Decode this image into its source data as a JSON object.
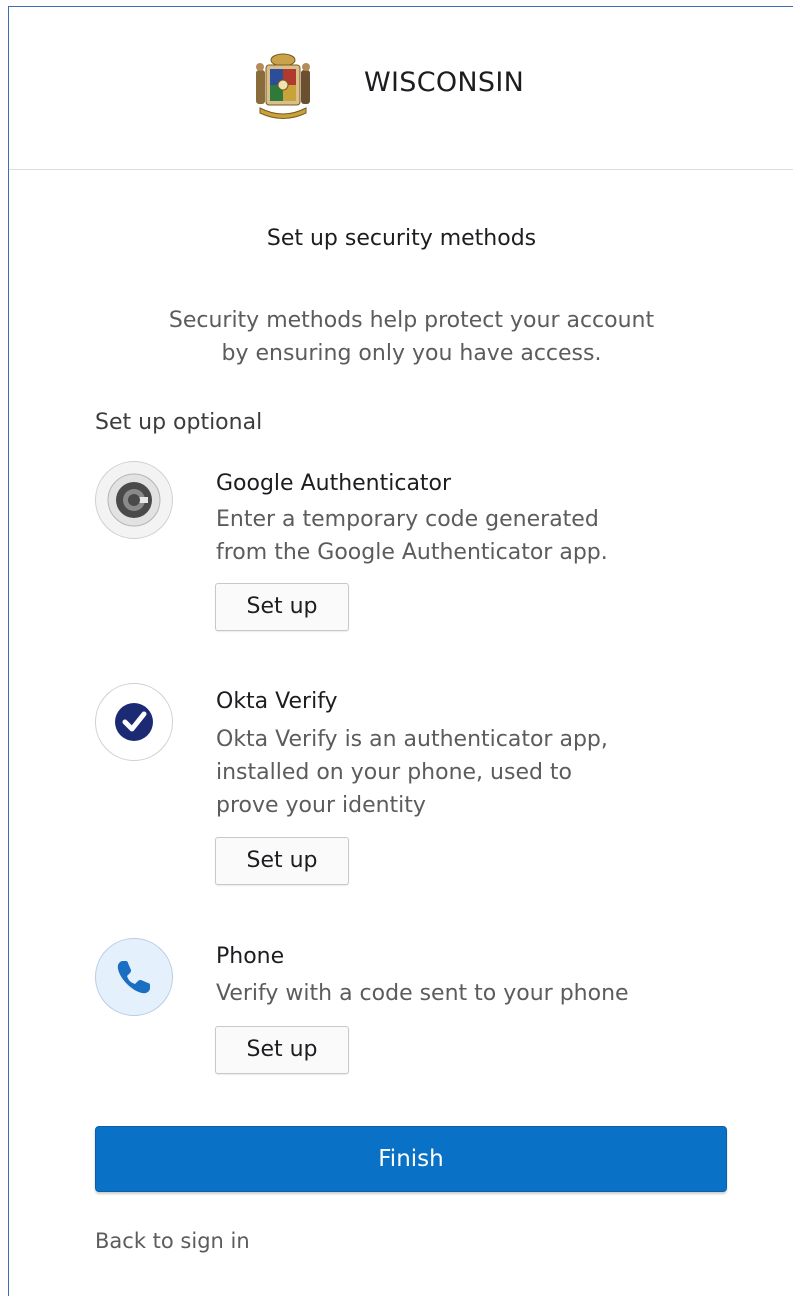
{
  "header": {
    "brand": "WISCONSIN",
    "seal_icon": "wisconsin-seal-icon"
  },
  "page": {
    "title": "Set up security methods",
    "subtitle_line1": "Security methods help protect your account",
    "subtitle_line2": "by ensuring only you have access.",
    "section_label": "Set up optional"
  },
  "methods": [
    {
      "icon": "google-authenticator-icon",
      "title": "Google Authenticator",
      "desc_lines": [
        "Enter a temporary code generated",
        "from the Google Authenticator app."
      ],
      "button": "Set up"
    },
    {
      "icon": "okta-verify-icon",
      "title": "Okta Verify",
      "desc_lines": [
        "Okta Verify is an authenticator app,",
        "installed on your phone, used to",
        "prove your identity"
      ],
      "button": "Set up"
    },
    {
      "icon": "phone-icon",
      "title": "Phone",
      "desc_lines": [
        "Verify with a code sent to your phone"
      ],
      "button": "Set up"
    }
  ],
  "actions": {
    "finish": "Finish",
    "back": "Back to sign in"
  },
  "colors": {
    "primary": "#0a72c6",
    "border_accent": "#3a6fb8",
    "okta_navy": "#1b2a73",
    "phone_blue": "#1a6fc2"
  }
}
